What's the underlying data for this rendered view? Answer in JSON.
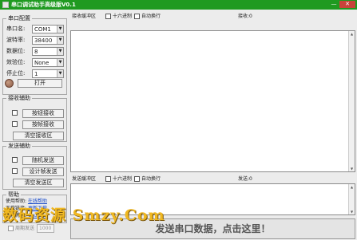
{
  "window": {
    "title": "串口调试助手高级版V0.1",
    "minimize_glyph": "—",
    "close_glyph": "✕"
  },
  "port_config": {
    "title": "串口配置",
    "fields": [
      {
        "label": "串口名:",
        "value": "COM1"
      },
      {
        "label": "波特率:",
        "value": "38400"
      },
      {
        "label": "数据位:",
        "value": "8"
      },
      {
        "label": "效验位:",
        "value": "None"
      },
      {
        "label": "停止位:",
        "value": "1"
      }
    ],
    "open_button": "打开",
    "status_led": {
      "color": "#a9735a",
      "state": "closed"
    }
  },
  "receive_assist": {
    "title": "接收辅助",
    "options": [
      {
        "label": "按钮接收",
        "checked": false
      },
      {
        "label": "按帧接收",
        "checked": false
      }
    ],
    "clear_button": "清空接收区"
  },
  "send_assist": {
    "title": "发送辅助",
    "options": [
      {
        "label": "随机发送",
        "checked": false
      },
      {
        "label": "设计帧发送",
        "checked": false
      }
    ],
    "clear_button": "清空发送区"
  },
  "help": {
    "title": "帮助",
    "lines": [
      {
        "label": "使用帮助:",
        "link": "在线帮助"
      },
      {
        "label": "下载链接:",
        "link": "更新下载"
      },
      {
        "label": "作者博客:",
        "link": "Csuhe..."
      }
    ]
  },
  "timer_send": {
    "label": "周期发送",
    "value": "1000",
    "enabled": false
  },
  "receive_panel": {
    "title": "接收缓冲区",
    "hex_label": "十六进制",
    "wrap_label": "自动换行",
    "count_label": "接收:0"
  },
  "send_panel": {
    "title": "发送缓冲区",
    "hex_label": "十六进制",
    "wrap_label": "自动换行",
    "count_label": "发送:0"
  },
  "send_button": "发送串口数据，点击这里！",
  "watermark_text": "数码资源 Smzy.Com",
  "colors": {
    "titlebar": "#1f9a20",
    "close": "#c9433a",
    "link": "#1447c8",
    "watermark": "#f0b821"
  }
}
